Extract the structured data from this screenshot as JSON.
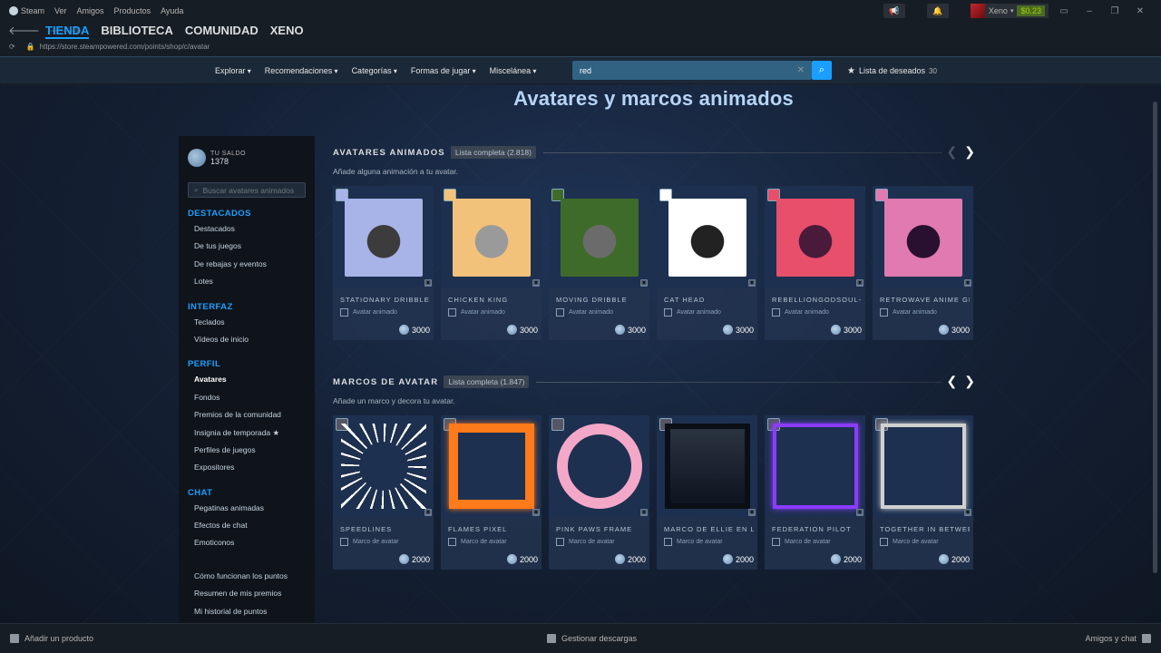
{
  "titlebar": {
    "app_name": "Steam",
    "menu": [
      "Ver",
      "Amigos",
      "Productos",
      "Ayuda"
    ],
    "account_name": "Xeno",
    "balance": "$0.23",
    "icons": {
      "announce": "megaphone-icon",
      "notify": "bell-icon"
    }
  },
  "nav": {
    "tabs": [
      "TIENDA",
      "BIBLIOTECA",
      "COMUNIDAD",
      "XENO"
    ],
    "url": "https://store.steampowered.com/points/shop/c/avatar"
  },
  "storenav": {
    "items": [
      "Explorar",
      "Recomendaciones",
      "Categorías",
      "Formas de jugar",
      "Miscelánea"
    ],
    "search_value": "red",
    "wishlist_label": "Lista de deseados",
    "wishlist_count": "30"
  },
  "page": {
    "title": "Avatares y marcos animados"
  },
  "sidebar": {
    "balance_label": "TU SALDO",
    "balance_value": "1378",
    "search_placeholder": "Buscar avatares animados",
    "sections": [
      {
        "heading": "DESTACADOS",
        "items": [
          "Destacados",
          "De tus juegos",
          "De rebajas y eventos",
          "Lotes"
        ]
      },
      {
        "heading": "INTERFAZ",
        "items": [
          "Teclados",
          "Vídeos de inicio"
        ]
      },
      {
        "heading": "PERFIL",
        "items": [
          "Avatares",
          "Fondos",
          "Premios de la comunidad",
          "Insignia de temporada ★",
          "Perfiles de juegos",
          "Expositores"
        ]
      },
      {
        "heading": "CHAT",
        "items": [
          "Pegatinas animadas",
          "Efectos de chat",
          "Emoticonos"
        ]
      }
    ],
    "extra": [
      "Cómo funcionan los puntos",
      "Resumen de mis premios",
      "Mi historial de puntos"
    ]
  },
  "avatars_section": {
    "title": "AVATARES ANIMADOS",
    "full_list": "Lista completa (2.818)",
    "description": "Añade alguna animación a tu avatar.",
    "type_label": "Avatar animado",
    "items": [
      {
        "name": "STATIONARY DRIBBLE",
        "price": "3000",
        "bg": "#a8b4e8",
        "fg": "#3c3c3c"
      },
      {
        "name": "CHICKEN KING",
        "price": "3000",
        "bg": "#f2c27a",
        "fg": "#9a9a9a"
      },
      {
        "name": "MOVING DRIBBLE",
        "price": "3000",
        "bg": "#3f6b2a",
        "fg": "#6b6b6b"
      },
      {
        "name": "CAT HEAD",
        "price": "3000",
        "bg": "#ffffff",
        "fg": "#222222"
      },
      {
        "name": "REBELLIONGODSOUL-U N",
        "price": "3000",
        "bg": "#e84f6a",
        "fg": "#4a1a3a"
      },
      {
        "name": "RETROWAVE ANIME GIRL",
        "price": "3000",
        "bg": "#e07ab0",
        "fg": "#2a1030"
      }
    ]
  },
  "frames_section": {
    "title": "MARCOS DE AVATAR",
    "full_list": "Lista completa (1.847)",
    "description": "Añade un marco y decora tu avatar.",
    "type_label": "Marco de avatar",
    "items": [
      {
        "name": "SPEEDLINES",
        "price": "2000",
        "color": "#ffffff"
      },
      {
        "name": "FLAMES PIXEL",
        "price": "2000",
        "color": "#ff7a1a"
      },
      {
        "name": "PINK PAWS FRAME",
        "price": "2000",
        "color": "#f4a8c8"
      },
      {
        "name": "MARCO DE ELLIE EN LA V",
        "price": "2000",
        "color": "#0d1520"
      },
      {
        "name": "FEDERATION PILOT",
        "price": "2000",
        "color": "#8a3cff"
      },
      {
        "name": "TOGETHER IN BETWEEN T",
        "price": "2000",
        "color": "#d0d0d0"
      }
    ]
  },
  "bottombar": {
    "add_product": "Añadir un producto",
    "downloads": "Gestionar descargas",
    "friends": "Amigos y chat"
  }
}
